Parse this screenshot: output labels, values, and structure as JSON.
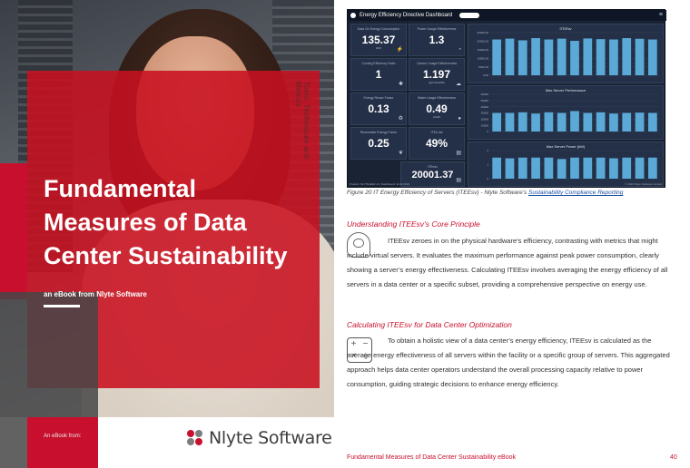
{
  "cover": {
    "vertical_tag": "Tools, Techniques and Metrics",
    "title": "Fundamental Measures of Data Center Sustainability",
    "subtitle": "an eBook from Nlyte Software",
    "ebook_from": "An eBook from:",
    "logo_text": "Nlyte Software",
    "colors": {
      "brand_red": "#c8102e",
      "dark_gray": "#464648"
    }
  },
  "dashboard": {
    "title": "Energy Efficiency Directive Dashboard",
    "kpis": [
      {
        "label": "Data Ctr Energy Consumption",
        "value": "135.37",
        "unit": "kWh"
      },
      {
        "label": "Power Usage Effectiveness",
        "value": "1.3",
        "unit": ""
      },
      {
        "label": "Cooling Efficiency Ratio",
        "value": "1",
        "unit": ""
      },
      {
        "label": "Carbon Usage Effectiveness",
        "value": "1.197",
        "unit": "kgCO2e/kWh"
      },
      {
        "label": "Energy Reuse Factor",
        "value": "0.13",
        "unit": ""
      },
      {
        "label": "Water Usage Effectiveness",
        "value": "0.49",
        "unit": "L/kWh"
      },
      {
        "label": "Renewable Energy Factor",
        "value": "0.25",
        "unit": ""
      },
      {
        "label": "ITEu est",
        "value": "49%",
        "unit": ""
      },
      {
        "label": "ITEesv",
        "value": "20001.37",
        "unit": ""
      }
    ],
    "footer_left": "Product: NLYTE EED v1 | Dashboard: 11.02.2024",
    "footer_right": "© 2024 Nlyte Software Limited",
    "panel_color": "#5aa9d6"
  },
  "chart_data": [
    {
      "type": "bar",
      "title": "ITEEsv",
      "ylim": [
        0,
        25000
      ],
      "yticks": [
        "25000.00",
        "20000.00",
        "15000.00",
        "10000.00",
        "5000.00",
        "0.00"
      ],
      "values": [
        21000,
        21500,
        20500,
        21800,
        21000,
        21500,
        20200,
        21600,
        21200,
        21000,
        21800,
        21400,
        21000
      ]
    },
    {
      "type": "bar",
      "title": "Max Server Performance",
      "ylim": [
        0,
        60000
      ],
      "yticks": [
        "60000",
        "50000",
        "40000",
        "30000",
        "20000",
        "10000",
        "0"
      ],
      "values": [
        30000,
        30000,
        31000,
        29000,
        31000,
        30000,
        33000,
        30000,
        31000,
        29000,
        30000,
        30500,
        30000
      ]
    },
    {
      "type": "bar",
      "title": "Max Server Power (kW)",
      "ylim": [
        0,
        2
      ],
      "yticks": [
        "2",
        "1",
        "0"
      ],
      "values": [
        1.5,
        1.45,
        1.5,
        1.5,
        1.5,
        1.4,
        1.5,
        1.5,
        1.5,
        1.45,
        1.5,
        1.5,
        1.5
      ]
    }
  ],
  "caption": {
    "text": "Figure 20 IT Energy Efficiency of Servers (ITEEsv) - Nlyte Software’s ",
    "link": "Sustainability Compliance Reporting"
  },
  "section1": {
    "heading": "Understanding ITEEsv’s Core Principle",
    "body": "ITEEsv zeroes in on the physical hardware’s efficiency, contrasting with metrics that might include virtual servers. It evaluates the maximum performance against peak power consumption, clearly showing a server’s energy effectiveness. Calculating ITEEsv involves averaging the energy efficiency of all servers in a data center or a specific subset, providing a comprehensive perspective on energy use."
  },
  "section2": {
    "heading": "Calculating ITEEsv for Data Center Optimization",
    "body": "To obtain a holistic view of a data center’s energy efficiency, ITEEsv is calculated as the average energy effectiveness of all servers within the facility or a specific group of servers. This aggregated approach helps data center operators understand the overall processing capacity relative to power consumption, guiding strategic decisions to enhance energy efficiency."
  },
  "footer": {
    "title": "Fundamental Measures of Data Center Sustainability eBook",
    "page": "40"
  }
}
